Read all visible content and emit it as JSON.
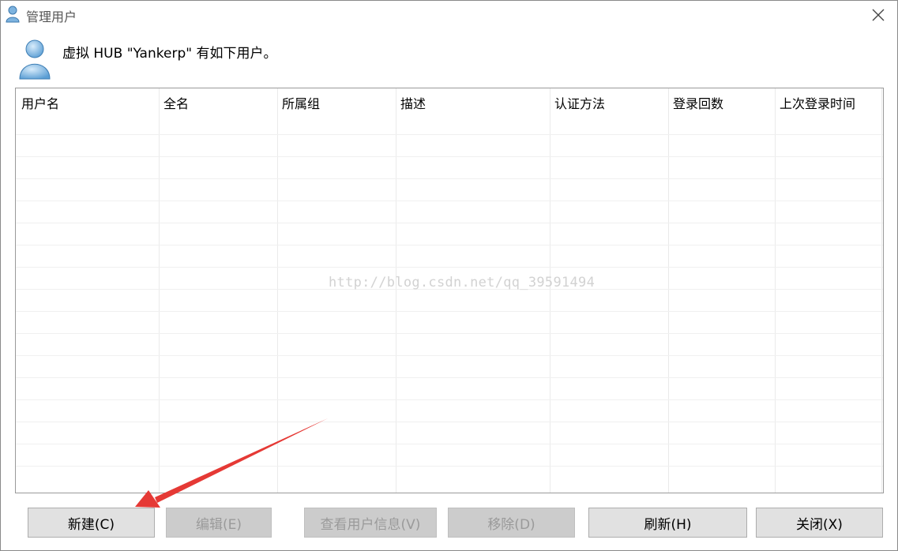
{
  "window": {
    "title": "管理用户"
  },
  "header": {
    "message": "虚拟 HUB \"Yankerp\" 有如下用户。"
  },
  "list": {
    "columns": [
      "用户名",
      "全名",
      "所属组",
      "描述",
      "认证方法",
      "登录回数",
      "上次登录时间"
    ],
    "rows": [],
    "watermark": "http://blog.csdn.net/qq_39591494"
  },
  "buttons": {
    "new": "新建(C)",
    "edit": "编辑(E)",
    "view": "查看用户信息(V)",
    "remove": "移除(D)",
    "refresh": "刷新(H)",
    "close": "关闭(X)"
  },
  "colors": {
    "arrow": "#e53935",
    "user_icon": "#6aa8d8"
  },
  "icons": {
    "title": "user-icon",
    "header": "user-icon",
    "close": "close-icon",
    "annotation": "red-arrow"
  }
}
